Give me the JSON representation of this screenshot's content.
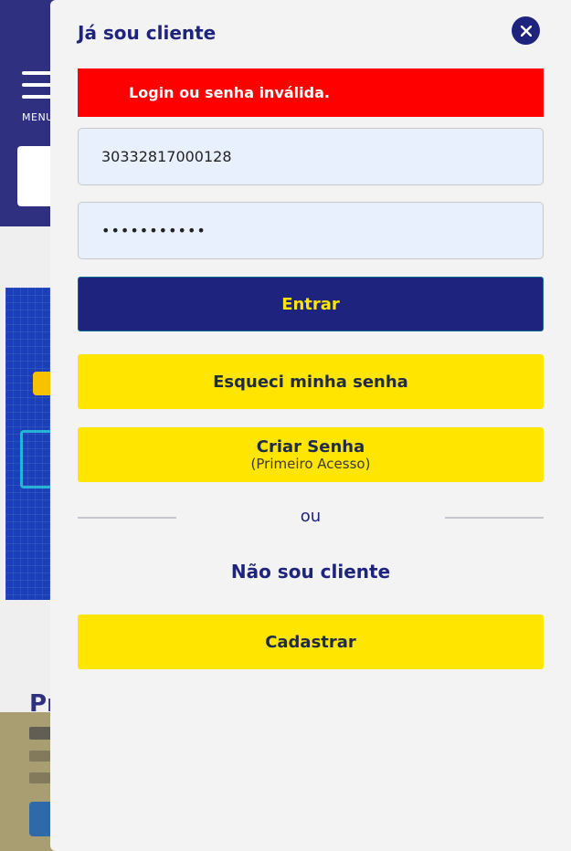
{
  "background": {
    "menu_label": "MENU",
    "heading_fragment": "Pr"
  },
  "modal": {
    "title": "Já sou cliente",
    "close_icon": "close-icon",
    "error_message": "Login ou senha inválida.",
    "username_value": "30332817000128",
    "password_value": "•••••••••••",
    "enter_label": "Entrar",
    "forgot_label": "Esqueci minha senha",
    "create_label": "Criar Senha",
    "create_sublabel": "(Primeiro Acesso)",
    "or_label": "ou",
    "not_client_label": "Não sou cliente",
    "register_label": "Cadastrar"
  },
  "colors": {
    "brand_navy": "#1e237e",
    "brand_yellow": "#ffe500",
    "error_red": "#ff0000",
    "input_bg": "#e8f0fe"
  }
}
